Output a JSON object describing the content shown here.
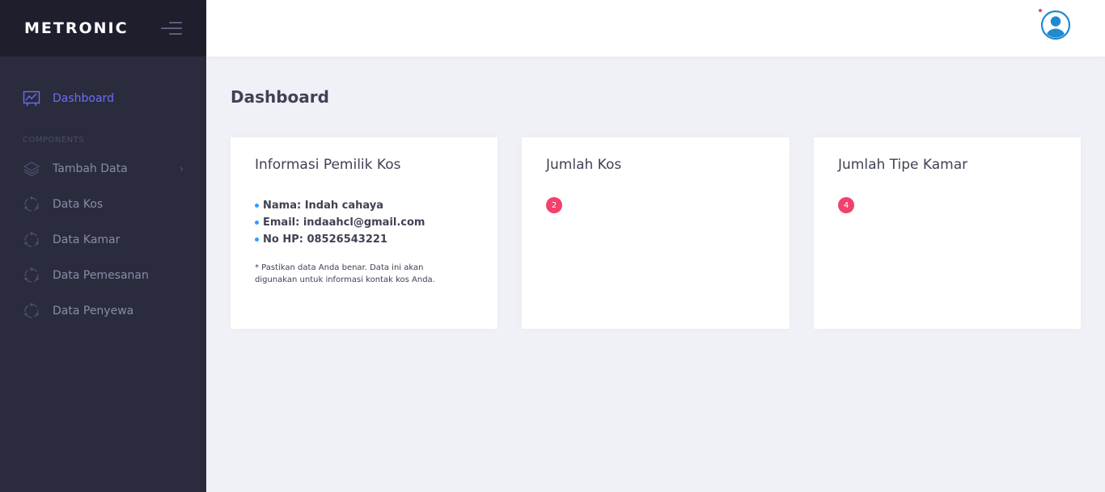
{
  "brand": {
    "name": "METRONIC"
  },
  "sidebar": {
    "items": [
      {
        "label": "Dashboard",
        "icon": "chart-line-icon"
      }
    ],
    "section_label": "COMPONENTS",
    "component_items": [
      {
        "label": "Tambah Data",
        "icon": "layers-icon",
        "arrow": "›"
      },
      {
        "label": "Data Kos",
        "icon": "circle-nodes-icon"
      },
      {
        "label": "Data Kamar",
        "icon": "circle-nodes-icon"
      },
      {
        "label": "Data Pemesanan",
        "icon": "circle-nodes-icon"
      },
      {
        "label": "Data Penyewa",
        "icon": "circle-nodes-icon"
      }
    ]
  },
  "header": {
    "avatar_icon": "user-avatar-icon"
  },
  "main": {
    "title": "Dashboard",
    "cards": {
      "owner": {
        "title": "Informasi Pemilik Kos",
        "name_line": "Nama: Indah cahaya",
        "email_line": "Email: indaahcl@gmail.com",
        "phone_line": "No HP: 08526543221",
        "note": "* Pastikan data Anda benar. Data ini akan digunakan untuk informasi kontak kos Anda."
      },
      "kos": {
        "title": "Jumlah Kos",
        "count": "2"
      },
      "tipe": {
        "title": "Jumlah Tipe Kamar",
        "count": "4"
      }
    }
  },
  "colors": {
    "sidebar_bg": "#2a2b3d",
    "brand_bg": "#1e1e2d",
    "accent": "#6c6ff1",
    "badge": "#f1416c",
    "bullet": "#3699ff",
    "page_bg": "#f0f1f7"
  }
}
